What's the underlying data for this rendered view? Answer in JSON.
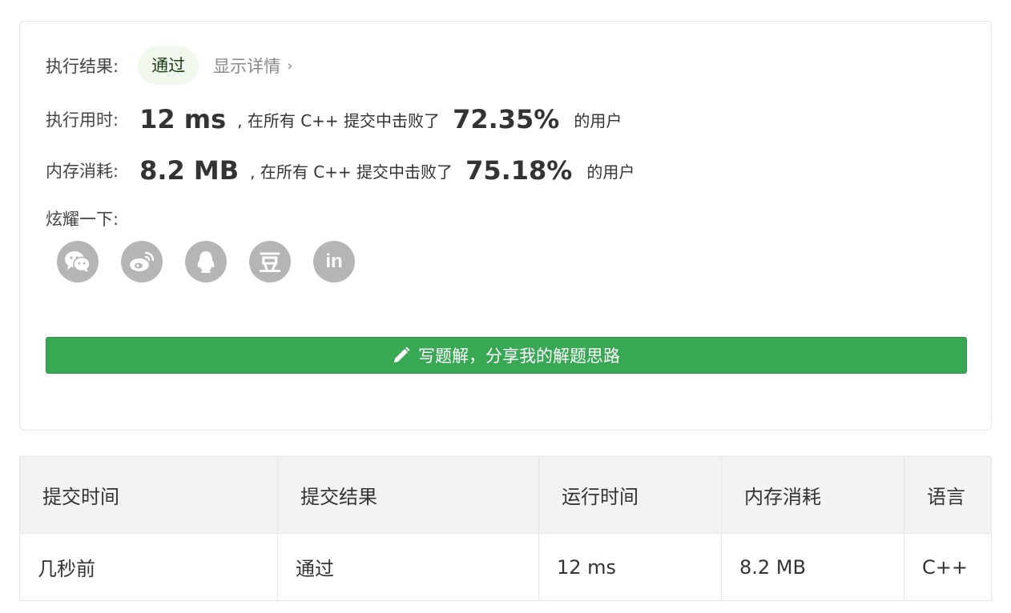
{
  "result": {
    "label": "执行结果:",
    "status": "通过",
    "details_link": "显示详情"
  },
  "runtime": {
    "label": "执行用时:",
    "value": "12 ms",
    "middle_text": ", 在所有 C++ 提交中击败了",
    "percent": "72.35%",
    "suffix": "的用户"
  },
  "memory": {
    "label": "内存消耗:",
    "value": "8.2 MB",
    "middle_text": ", 在所有 C++ 提交中击败了",
    "percent": "75.18%",
    "suffix": "的用户"
  },
  "share": {
    "label": "炫耀一下:",
    "icons": [
      "wechat-icon",
      "weibo-icon",
      "qq-icon",
      "douban-icon",
      "linkedin-icon"
    ],
    "douban_glyph": "豆",
    "linkedin_glyph": "in"
  },
  "write_button": {
    "label": "写题解，分享我的解题思路"
  },
  "submissions_table": {
    "columns": [
      "提交时间",
      "提交结果",
      "运行时间",
      "内存消耗",
      "语言"
    ],
    "rows": [
      [
        "几秒前",
        "通过",
        "12 ms",
        "8.2 MB",
        "C++"
      ]
    ]
  },
  "colors": {
    "accent_green": "#38a854",
    "pass_green": "#5cad36",
    "icon_gray": "#b5b5b5"
  }
}
